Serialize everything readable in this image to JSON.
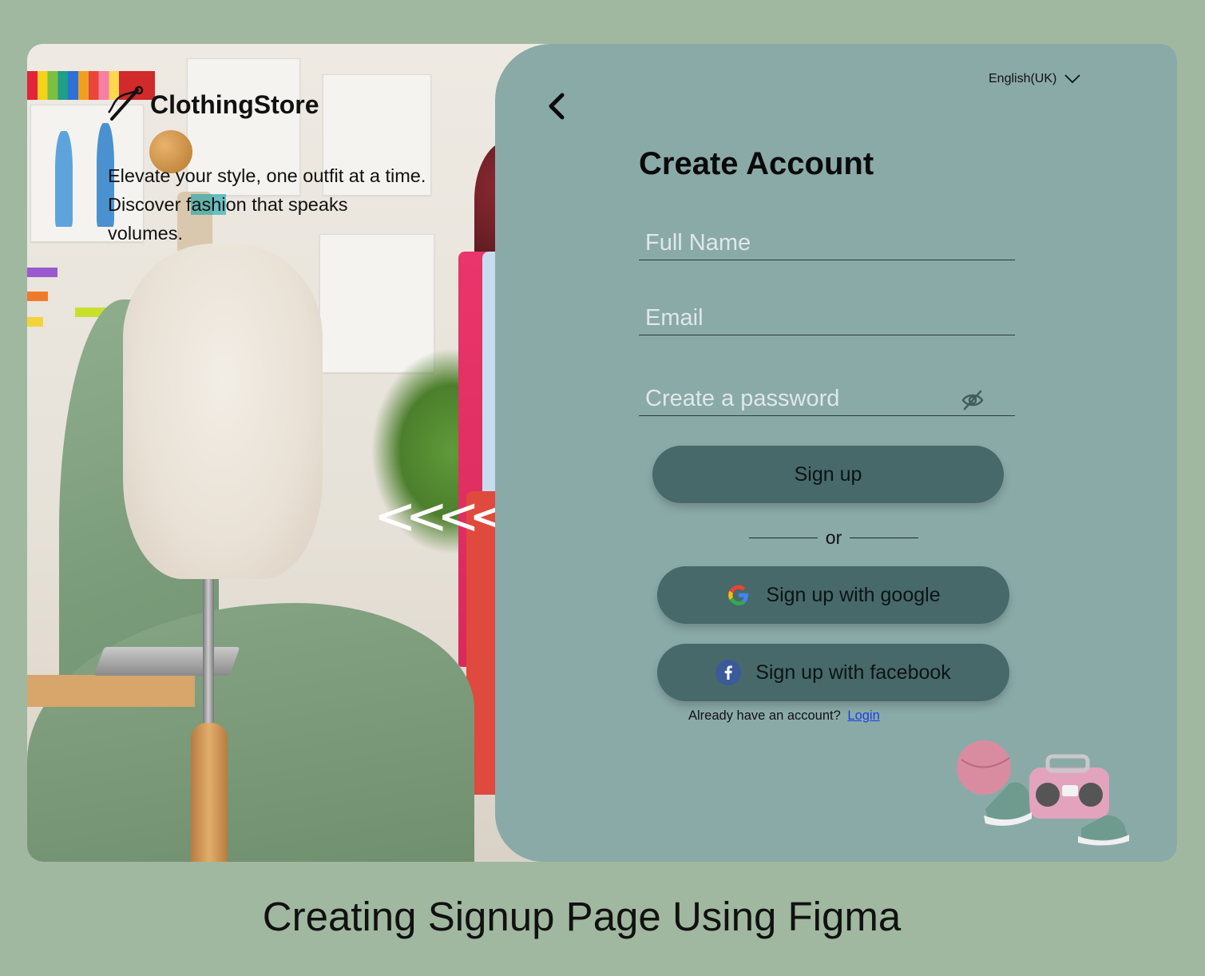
{
  "brand": {
    "name": "ClothingStore",
    "logo_icon": "needle-thread-icon"
  },
  "hero": {
    "tagline_before": "Elevate your style, one outfit at a time. Discover f",
    "tagline_highlight": "ashi",
    "tagline_after": "on that speaks volumes.",
    "carousel_icon": "chevrons-left-icon",
    "carousel_glyph": "<<<<<"
  },
  "header": {
    "language": "English(UK)",
    "language_icon": "chevron-down-icon",
    "back_icon": "chevron-left-icon"
  },
  "form": {
    "title": "Create Account",
    "full_name": {
      "placeholder": "Full Name",
      "value": ""
    },
    "email": {
      "placeholder": "Email",
      "value": ""
    },
    "password": {
      "placeholder": "Create a password",
      "value": "",
      "toggle_icon": "eye-off-icon"
    },
    "signup_label": "Sign up",
    "divider_label": "or",
    "google_label": "Sign up with google",
    "facebook_label": "Sign up with facebook",
    "already_text": "Already have an account?",
    "login_label": "Login"
  },
  "caption": "Creating Signup Page Using Figma",
  "colors": {
    "background": "#a1b8a0",
    "panel": "#8aaaa8",
    "button": "#47696a",
    "link": "#1a3ee8"
  }
}
